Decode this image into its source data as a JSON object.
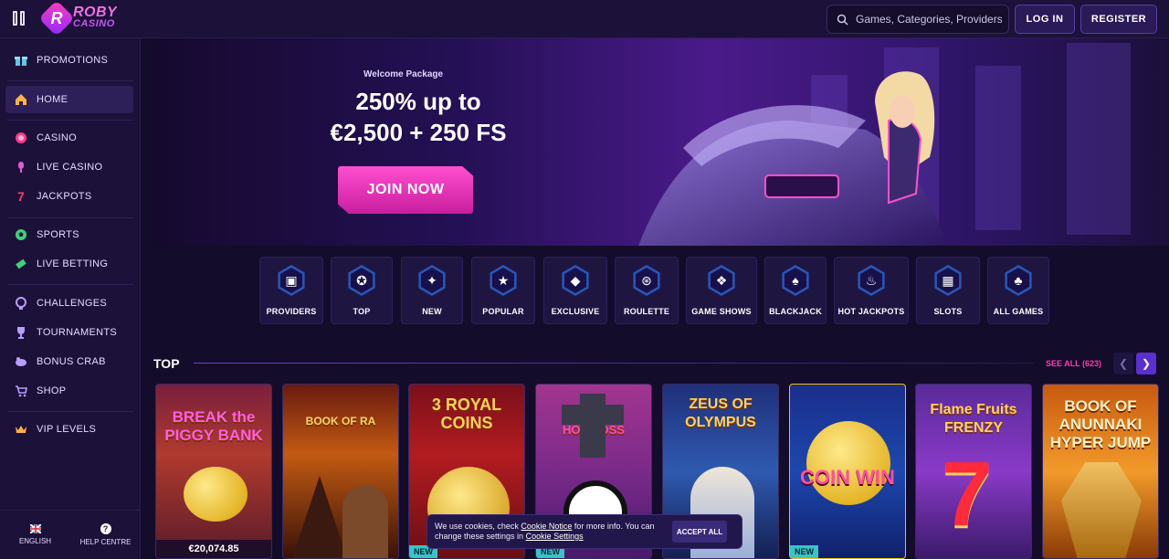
{
  "header": {
    "logo_line1": "ROBY",
    "logo_line2": "CASINO",
    "search_placeholder": "Games, Categories, Providers",
    "login_label": "LOG IN",
    "register_label": "REGISTER"
  },
  "sidebar": {
    "items": [
      {
        "label": "PROMOTIONS",
        "icon": "gift-icon"
      },
      {
        "label": "HOME",
        "icon": "home-icon"
      },
      {
        "label": "CASINO",
        "icon": "chip-icon"
      },
      {
        "label": "LIVE CASINO",
        "icon": "microphone-icon"
      },
      {
        "label": "JACKPOTS",
        "icon": "seven-icon"
      },
      {
        "label": "SPORTS",
        "icon": "soccer-ball-icon"
      },
      {
        "label": "LIVE BETTING",
        "icon": "ticket-icon"
      },
      {
        "label": "CHALLENGES",
        "icon": "medal-icon"
      },
      {
        "label": "TOURNAMENTS",
        "icon": "trophy-icon"
      },
      {
        "label": "BONUS CRAB",
        "icon": "crab-icon"
      },
      {
        "label": "SHOP",
        "icon": "cart-icon"
      },
      {
        "label": "VIP LEVELS",
        "icon": "crown-icon"
      }
    ],
    "footer": {
      "language": "ENGLISH",
      "help": "HELP CENTRE"
    }
  },
  "hero": {
    "eyebrow": "Welcome Package",
    "line1": "250% up to",
    "line2": "€2,500 + 250 FS",
    "cta": "JOIN NOW"
  },
  "categories": [
    {
      "label": "PROVIDERS",
      "icon": "folder-icon"
    },
    {
      "label": "TOP",
      "icon": "rosette-icon"
    },
    {
      "label": "NEW",
      "icon": "sparkle-icon"
    },
    {
      "label": "POPULAR",
      "icon": "star-icon"
    },
    {
      "label": "EXCLUSIVE",
      "icon": "diamond-icon"
    },
    {
      "label": "ROULETTE",
      "icon": "roulette-icon"
    },
    {
      "label": "GAME SHOWS",
      "icon": "show-icon"
    },
    {
      "label": "BLACKJACK",
      "icon": "spade-icon"
    },
    {
      "label": "HOT JACKPOTS",
      "icon": "flame-icon"
    },
    {
      "label": "SLOTS",
      "icon": "slot-machine-icon"
    },
    {
      "label": "ALL GAMES",
      "icon": "cherries-icon"
    }
  ],
  "top_section": {
    "title": "TOP",
    "see_all": "SEE ALL (623)",
    "games": [
      {
        "title": "BREAK the PIGGY BANK",
        "jackpot": "€20,074.85",
        "badge": ""
      },
      {
        "title": "BOOK OF RA",
        "jackpot": "",
        "badge": ""
      },
      {
        "title": "3 ROYAL COINS",
        "jackpot": "",
        "badge": "NEW"
      },
      {
        "title": "HOT ROSS",
        "jackpot": "",
        "badge": "NEW"
      },
      {
        "title": "ZEUS OF OLYMPUS",
        "jackpot": "",
        "badge": ""
      },
      {
        "title": "COIN WIN",
        "jackpot": "",
        "badge": "NEW"
      },
      {
        "title": "Flame Fruits FRENZY",
        "jackpot": "",
        "badge": ""
      },
      {
        "title": "BOOK OF ANUNNAKI HYPER JUMP",
        "jackpot": "",
        "badge": ""
      }
    ]
  },
  "cookie": {
    "text1": "We use cookies, check ",
    "link1": "Cookie Notice",
    "text2": " for more info. You can change these settings in ",
    "link2": "Cookie Settings",
    "accept": "ACCEPT ALL"
  },
  "colors": {
    "accent": "#ff3bb0",
    "primary": "#5a2fd0",
    "background": "#130c2a"
  }
}
